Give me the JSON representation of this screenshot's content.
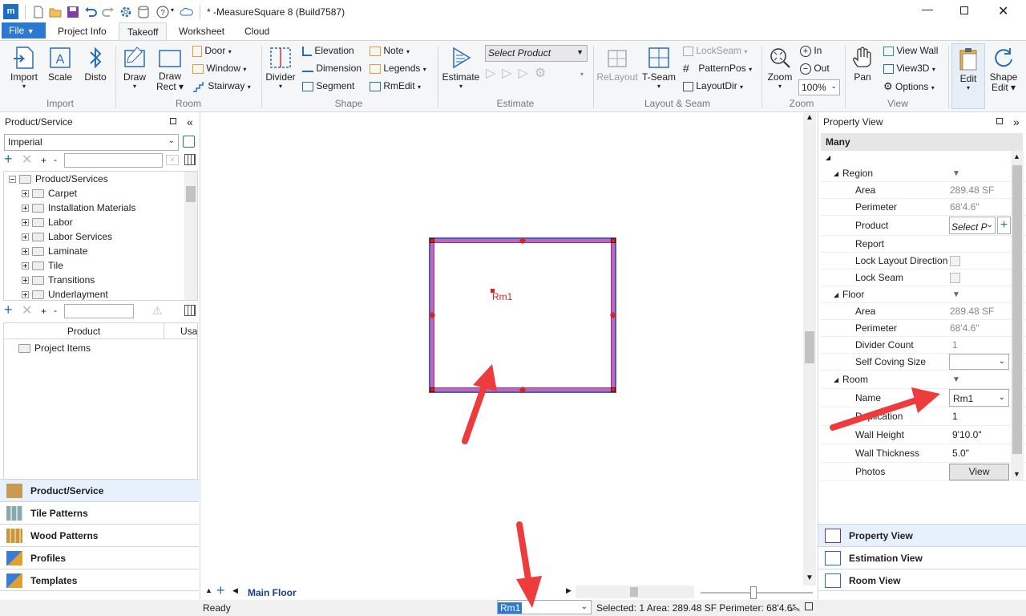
{
  "title": "* -MeasureSquare 8 (Build7587)",
  "menu": {
    "file": "File",
    "tabs": [
      "Project Info",
      "Takeoff",
      "Worksheet",
      "Cloud"
    ],
    "active": "Takeoff"
  },
  "ribbon": {
    "import": {
      "import": "Import",
      "scale": "Scale",
      "disto": "Disto",
      "group": "Import"
    },
    "room": {
      "draw": "Draw",
      "draw_rect": "Draw\nRect",
      "door": "Door",
      "window": "Window",
      "stairway": "Stairway",
      "group": "Room"
    },
    "shape": {
      "divider": "Divider",
      "elevation": "Elevation",
      "dimension": "Dimension",
      "segment": "Segment",
      "note": "Note",
      "legends": "Legends",
      "rmedit": "RmEdit",
      "group": "Shape"
    },
    "estimate": {
      "estimate": "Estimate",
      "select_product": "Select Product",
      "group": "Estimate"
    },
    "layout": {
      "relayout": "ReLayout",
      "tseam": "T-Seam",
      "lockseam": "LockSeam",
      "patternpos": "PatternPos",
      "layoutdir": "LayoutDir",
      "group": "Layout & Seam"
    },
    "zoom": {
      "zoom": "Zoom",
      "in": "In",
      "out": "Out",
      "level": "100%",
      "group": "Zoom"
    },
    "view": {
      "pan": "Pan",
      "view_wall": "View Wall",
      "view3d": "View3D",
      "options": "Options",
      "group": "View"
    },
    "edit": {
      "edit": "Edit",
      "shape_edit": "Shape Edit"
    }
  },
  "left": {
    "header": "Product/Service",
    "unit": "Imperial",
    "tree_root": "Product/Services",
    "tree_items": [
      "Carpet",
      "Installation Materials",
      "Labor",
      "Labor Services",
      "Laminate",
      "Tile",
      "Transitions",
      "Underlayment"
    ],
    "col_product": "Product",
    "col_usage": "Usag",
    "project_items": "Project Items",
    "nav": [
      "Product/Service",
      "Tile Patterns",
      "Wood Patterns",
      "Profiles",
      "Templates"
    ]
  },
  "canvas": {
    "room_label": "Rm1",
    "floor_tab": "Main Floor"
  },
  "right": {
    "header": "Property View",
    "selection": "Many",
    "sections": {
      "region": {
        "label": "Region",
        "area_l": "Area",
        "area": "289.48 SF",
        "perim_l": "Perimeter",
        "perim": "68'4.6\"",
        "product_l": "Product",
        "product": "Select P",
        "report_l": "Report",
        "lld_l": "Lock Layout Direction",
        "lockseam_l": "Lock Seam"
      },
      "floor": {
        "label": "Floor",
        "area_l": "Area",
        "area": "289.48 SF",
        "perim_l": "Perimeter",
        "perim": "68'4.6\"",
        "div_l": "Divider Count",
        "div": "1",
        "cov_l": "Self Coving Size"
      },
      "room": {
        "label": "Room",
        "name_l": "Name",
        "name": "Rm1",
        "dup_l": "Duplication",
        "dup": "1",
        "wh_l": "Wall Height",
        "wh": "9'10.0\"",
        "wt_l": "Wall Thickness",
        "wt": "5.0\"",
        "ph_l": "Photos",
        "ph": "View"
      }
    },
    "nav": [
      "Property View",
      "Estimation View",
      "Room View"
    ]
  },
  "status": {
    "ready": "Ready",
    "room_combo": "Rm1",
    "selection": "Selected: 1 Area: 289.48 SF Perimeter: 68'4.6\""
  }
}
